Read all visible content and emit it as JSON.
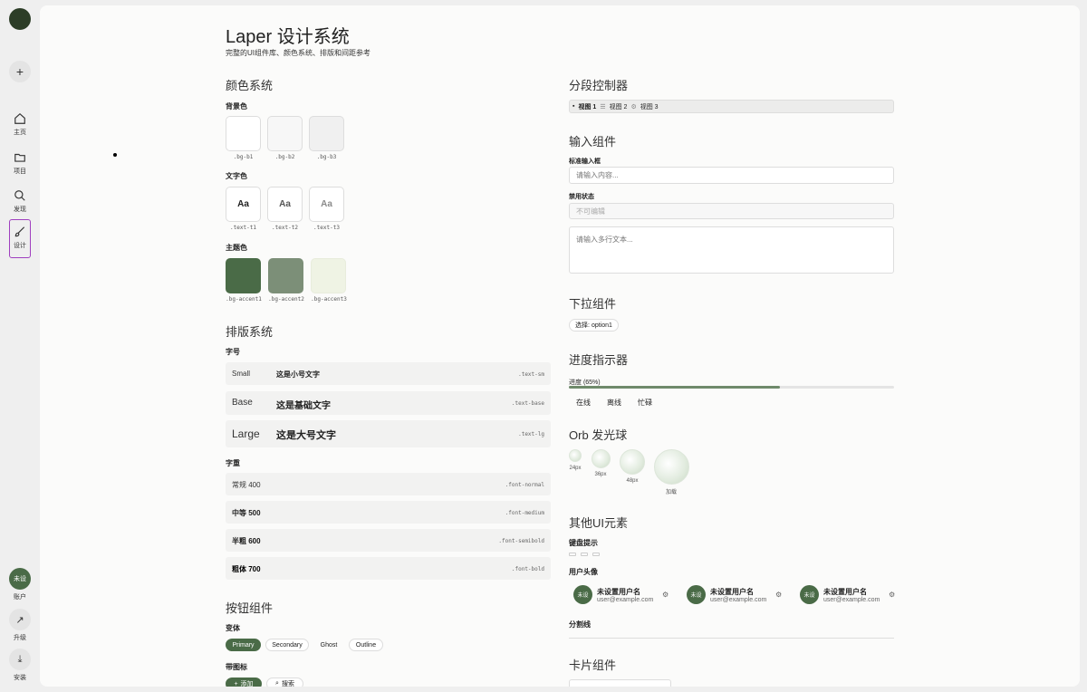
{
  "sidebar": {
    "nav": [
      {
        "label": "主页",
        "icon": "home-icon"
      },
      {
        "label": "项目",
        "icon": "folder-icon"
      },
      {
        "label": "发现",
        "icon": "search-icon"
      },
      {
        "label": "设计",
        "icon": "brush-icon"
      }
    ],
    "account": {
      "avatar": "未设",
      "label": "账户"
    },
    "upgrade": {
      "label": "升级"
    },
    "install": {
      "label": "安装"
    }
  },
  "header": {
    "title": "Laper 设计系统",
    "subtitle": "完整的UI组件库、颜色系统、排版和间距参考"
  },
  "colors": {
    "title": "颜色系统",
    "bg": {
      "label": "背景色",
      "items": [
        {
          "name": ".bg-b1",
          "color": "#ffffff"
        },
        {
          "name": ".bg-b2",
          "color": "#f7f7f7"
        },
        {
          "name": ".bg-b3",
          "color": "#f0f0f0"
        }
      ]
    },
    "text": {
      "label": "文字色",
      "sample": "Aa",
      "items": [
        {
          "name": ".text-t1",
          "color": "#1f1f1f"
        },
        {
          "name": ".text-t2",
          "color": "#555555"
        },
        {
          "name": ".text-t3",
          "color": "#8a8a8a"
        }
      ]
    },
    "theme": {
      "label": "主题色",
      "items": [
        {
          "name": ".bg-accent1",
          "color": "#4a6b47"
        },
        {
          "name": ".bg-accent2",
          "color": "#7c8f78"
        },
        {
          "name": ".bg-accent3",
          "color": "#eff3e4"
        }
      ]
    }
  },
  "typography": {
    "title": "排版系统",
    "sizes_label": "字号",
    "sizes": [
      {
        "a": "Small",
        "b": "这是小号文字",
        "c": ".text-sm"
      },
      {
        "a": "Base",
        "b": "这是基础文字",
        "c": ".text-base"
      },
      {
        "a": "Large",
        "b": "这是大号文字",
        "c": ".text-lg"
      }
    ],
    "weights_label": "字重",
    "weights": [
      {
        "a": "常规 400",
        "c": ".font-normal"
      },
      {
        "a": "中等 500",
        "c": ".font-medium"
      },
      {
        "a": "半粗 600",
        "c": ".font-semibold"
      },
      {
        "a": "粗体 700",
        "c": ".font-bold"
      }
    ]
  },
  "buttons": {
    "title": "按钮组件",
    "variants_label": "变体",
    "variants": [
      "Primary",
      "Secondary",
      "Ghost",
      "Outline"
    ],
    "icons_label": "带图标",
    "add": "添加",
    "search": "搜索"
  },
  "segmented": {
    "title": "分段控制器",
    "items": [
      "视图 1",
      "视图 2",
      "视图 3"
    ]
  },
  "inputs": {
    "title": "输入组件",
    "standard_label": "标准输入框",
    "standard_placeholder": "请输入内容...",
    "disabled_label": "禁用状态",
    "disabled_value": "不可编辑",
    "textarea_placeholder": "请输入多行文本..."
  },
  "dropdown": {
    "title": "下拉组件",
    "value": "选择: option1"
  },
  "progress": {
    "title": "进度指示器",
    "label": "进度 (65%)",
    "value": 0.65,
    "statuses": [
      "在线",
      "离线",
      "忙碌"
    ]
  },
  "orb": {
    "title": "Orb 发光球",
    "items": [
      "24px",
      "36px",
      "48px",
      "加载"
    ]
  },
  "other": {
    "title": "其他UI元素",
    "kbd_label": "键盘提示",
    "avatar_label": "用户头像",
    "users": [
      {
        "avatar": "未设",
        "name": "未设置用户名",
        "email": "user@example.com"
      },
      {
        "avatar": "未设",
        "name": "未设置用户名",
        "email": "user@example.com"
      },
      {
        "avatar": "未设",
        "name": "未设置用户名",
        "email": "user@example.com"
      }
    ],
    "divider_label": "分割线"
  },
  "cards": {
    "title": "卡片组件"
  }
}
